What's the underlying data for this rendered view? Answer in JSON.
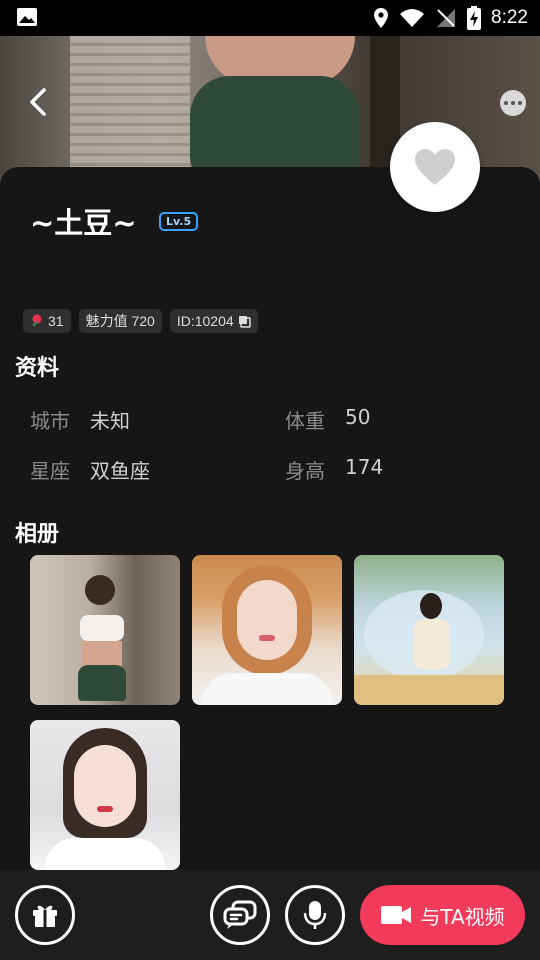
{
  "status_bar": {
    "time": "8:22"
  },
  "profile": {
    "name": "~土豆~",
    "level": "Lv.5",
    "badges": {
      "rose_count": "31",
      "charm": "魅力值 720",
      "user_id": "ID:10204"
    }
  },
  "info": {
    "title": "资料",
    "city_label": "城市",
    "city_value": "未知",
    "weight_label": "体重",
    "weight_value": "50",
    "zodiac_label": "星座",
    "zodiac_value": "双鱼座",
    "height_label": "身高",
    "height_value": "174"
  },
  "album": {
    "title": "相册",
    "photo_count": 4
  },
  "actions": {
    "video_call_label": "与TA视频"
  },
  "colors": {
    "accent": "#f23a5b",
    "level_border": "#3aa1ff",
    "background": "#161616"
  }
}
